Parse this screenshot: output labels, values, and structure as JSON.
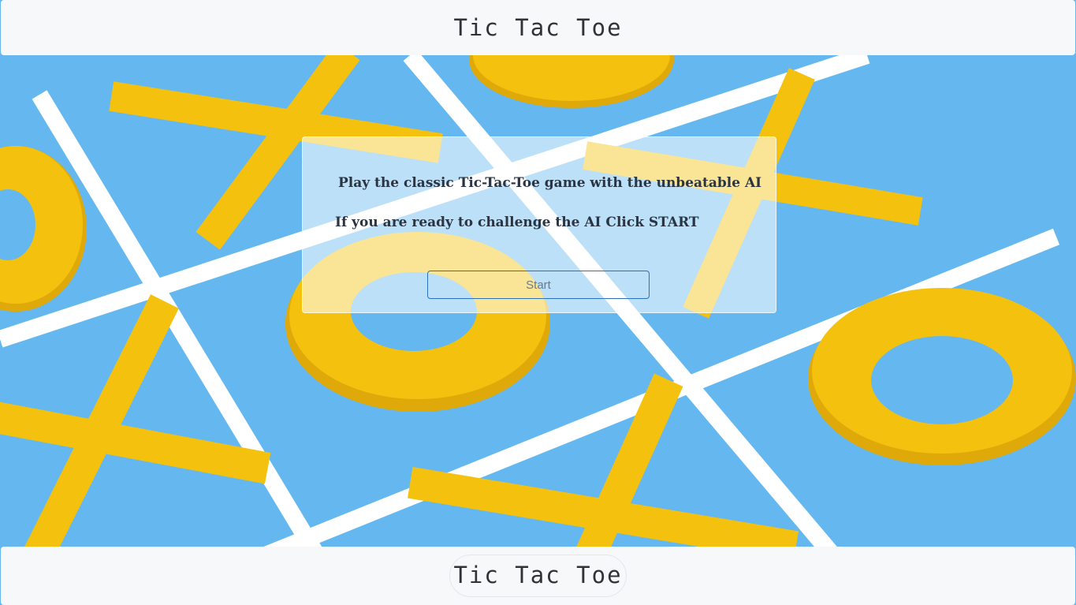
{
  "header": {
    "title": "Tic Tac Toe"
  },
  "footer": {
    "title": "Tic Tac Toe"
  },
  "intro": {
    "line1": "Play the classic Tic-Tac-Toe game with the unbeatable AI",
    "line2": "If you are ready to challenge the AI Click START",
    "start_label": "Start"
  },
  "background": {
    "board_color": "#64b8ef",
    "line_color": "#ffffff",
    "piece_color": "#f4c10f",
    "pieces": [
      "x-piece",
      "o-piece",
      "x-piece",
      "o-piece",
      "x-piece",
      "o-piece",
      "x-piece",
      "o-piece",
      "x-piece"
    ]
  }
}
